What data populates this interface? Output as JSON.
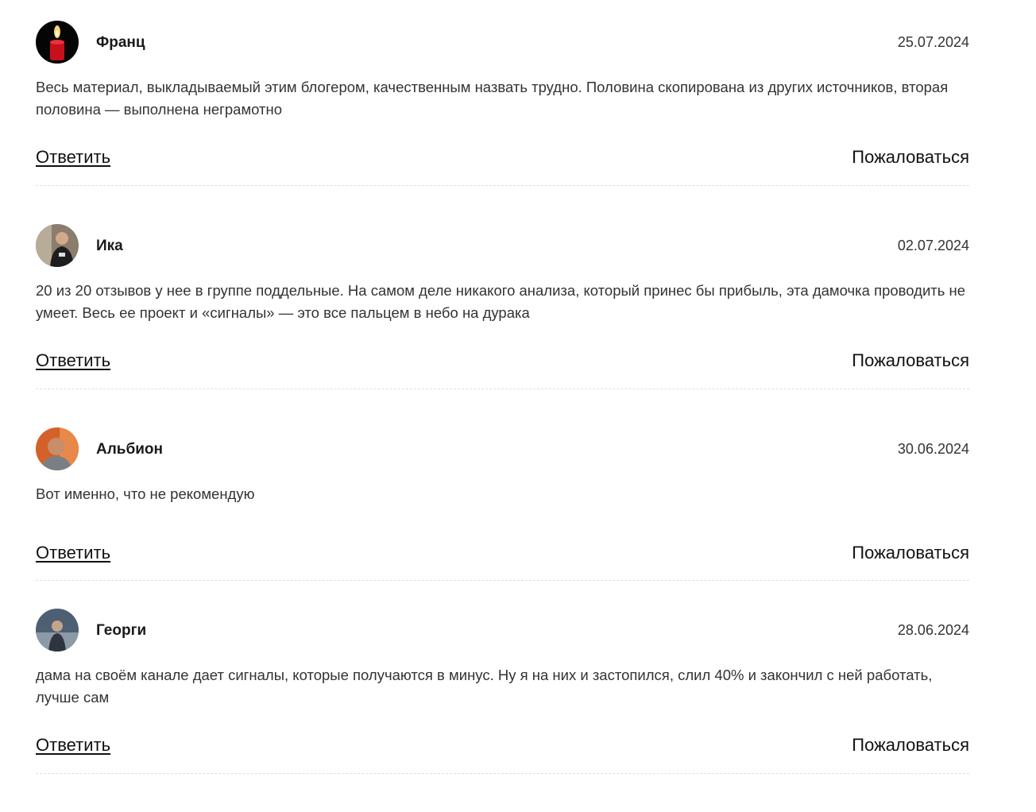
{
  "comments": [
    {
      "author": "Франц",
      "date": "25.07.2024",
      "text": "Весь материал, выкладываемый этим блогером, качественным назвать трудно. Половина скопирована из других источников, вторая половина — выполнена неграмотно",
      "reply_label": "Ответить",
      "report_label": "Пожаловаться",
      "avatar": "candle-avatar"
    },
    {
      "author": "Ика",
      "date": "02.07.2024",
      "text": "20 из 20 отзывов у нее в группе поддельные. На самом деле никакого анализа, который принес бы прибыль, эта дамочка проводить не умеет. Весь ее проект и «сигналы» — это все пальцем в небо на дурака",
      "reply_label": "Ответить",
      "report_label": "Пожаловаться",
      "avatar": "user-photo-avatar"
    },
    {
      "author": "Альбион",
      "date": "30.06.2024",
      "text": "Вот именно, что не рекомендую",
      "reply_label": "Ответить",
      "report_label": "Пожаловаться",
      "avatar": "user-photo-avatar"
    },
    {
      "author": "Георги",
      "date": "28.06.2024",
      "text": "дама на своём канале дает сигналы, которые получаются в минус. Ну я на них и застопился, слил 40% и закончил с ней работать, лучше сам",
      "reply_label": "Ответить",
      "report_label": "Пожаловаться",
      "avatar": "user-photo-avatar"
    }
  ]
}
